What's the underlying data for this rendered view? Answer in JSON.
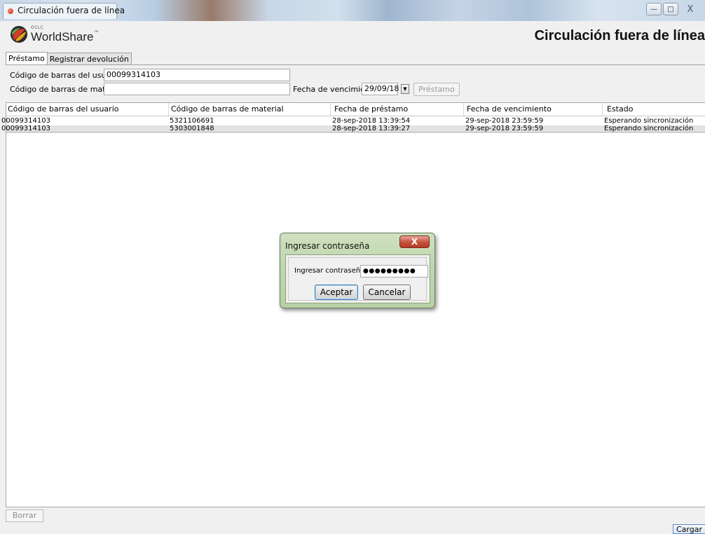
{
  "window": {
    "title": "Circulación fuera de línea",
    "controls": {
      "minimize": "—",
      "maximize": "□",
      "close": "X"
    }
  },
  "header": {
    "logo_small": "OCLC",
    "logo_name": "WorldShare",
    "logo_tm": "™",
    "page_title": "Circulación fuera de línea"
  },
  "tabs": [
    {
      "label": "Préstamo",
      "active": true
    },
    {
      "label": "Registrar devolución",
      "active": false
    }
  ],
  "form": {
    "user_barcode_label": "Código de barras del usuario",
    "user_barcode_value": "00099314103",
    "item_barcode_label": "Código de barras de material",
    "item_barcode_value": "",
    "due_date_label": "Fecha de vencimiento",
    "due_date_value": "29/09/18",
    "loan_button": "Préstamo"
  },
  "table": {
    "columns": [
      "Código de barras del usuario",
      "Código de barras de material",
      "Fecha de préstamo",
      "Fecha de vencimiento",
      "Estado"
    ],
    "rows": [
      [
        "00099314103",
        "5321106691",
        "28-sep-2018 13:39:54",
        "29-sep-2018 23:59:59",
        "Esperando sincronización"
      ],
      [
        "00099314103",
        "5303001848",
        "28-sep-2018 13:39:27",
        "29-sep-2018 23:59:59",
        "Esperando sincronización"
      ]
    ]
  },
  "footer": {
    "delete_button": "Borrar",
    "load_button": "Cargar"
  },
  "dialog": {
    "title": "Ingresar contraseña",
    "close": "X",
    "field_label": "Ingresar contraseña",
    "field_value": "●●●●●●●●●",
    "accept": "Aceptar",
    "cancel": "Cancelar"
  },
  "colors": {
    "dialog_frame": "#c1d8ae",
    "close_button": "#c8503c",
    "selected_row": "#e2e2e2"
  }
}
